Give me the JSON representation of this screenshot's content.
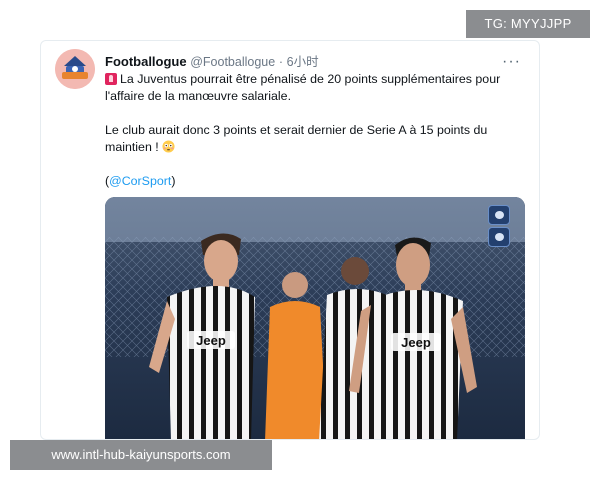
{
  "watermark": {
    "tg": "TG: MYYJJPP",
    "site": "www.intl-hub-kaiyunsports.com"
  },
  "tweet": {
    "author_name": "Footballogue",
    "handle": "@Footballogue",
    "separator": "·",
    "time": "6小时",
    "more": "···",
    "line1": "La Juventus pourrait être pénalisé de 20 points supplémentaires pour",
    "line2": "l'affaire de la manœuvre salariale.",
    "line3": "Le club aurait donc 3 points et serait dernier de Serie A à 15 points du",
    "line4": "maintien !",
    "source_open": "(",
    "mention": "@CorSport",
    "source_close": ")"
  },
  "photo": {
    "left_player_shirt": "Jeep",
    "right_player_shirt": "Jeep"
  },
  "colors": {
    "accent": "#1d9bf0",
    "alarm": "#e0245e",
    "watermark_bg": "#8b8d90"
  },
  "icons": [
    "avatar-logo",
    "alarm-emoji",
    "flushed-face-emoji",
    "more-icon"
  ]
}
